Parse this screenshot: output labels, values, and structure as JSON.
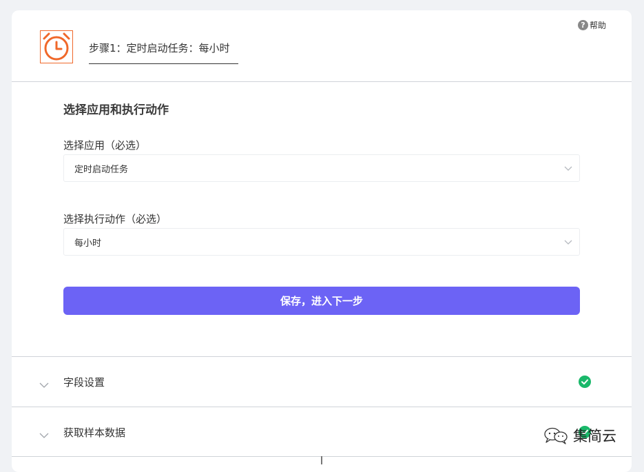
{
  "header": {
    "help_label": "帮助",
    "help_icon": "question-icon",
    "app_icon": "alarm-clock-icon",
    "step_title": "步骤1：定时启动任务：每小时"
  },
  "main": {
    "section_title": "选择应用和执行动作",
    "app_field": {
      "label": "选择应用（必选）",
      "value": "定时启动任务"
    },
    "action_field": {
      "label": "选择执行动作（必选）",
      "value": "每小时"
    },
    "save_button": "保存，进入下一步"
  },
  "sections": [
    {
      "label": "字段设置",
      "status": "complete"
    },
    {
      "label": "获取样本数据",
      "status": "complete"
    }
  ],
  "watermark": {
    "text": "集简云",
    "icon": "wechat-icon"
  },
  "colors": {
    "accent": "#6c63f5",
    "brand_orange": "#f0682a",
    "success": "#19b86a",
    "page_bg": "#f0f2f5"
  }
}
